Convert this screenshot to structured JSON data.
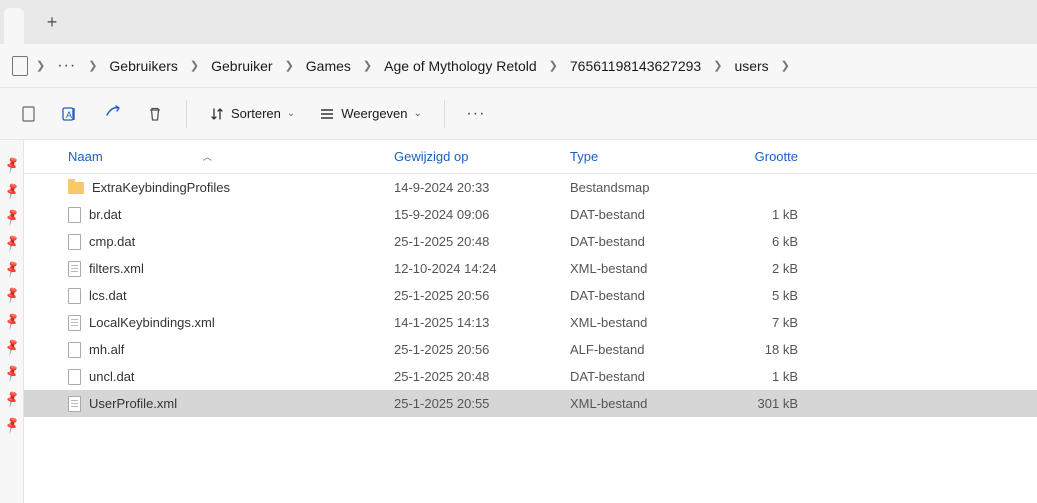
{
  "breadcrumb": [
    "Gebruikers",
    "Gebruiker",
    "Games",
    "Age of Mythology Retold",
    "76561198143627293",
    "users"
  ],
  "toolbar": {
    "sort": "Sorteren",
    "view": "Weergeven"
  },
  "columns": {
    "name": "Naam",
    "modified": "Gewijzigd op",
    "type": "Type",
    "size": "Grootte"
  },
  "files": [
    {
      "icon": "folder",
      "name": "ExtraKeybindingProfiles",
      "modified": "14-9-2024 20:33",
      "type": "Bestandsmap",
      "size": "",
      "selected": false
    },
    {
      "icon": "file",
      "name": "br.dat",
      "modified": "15-9-2024 09:06",
      "type": "DAT-bestand",
      "size": "1 kB",
      "selected": false
    },
    {
      "icon": "file",
      "name": "cmp.dat",
      "modified": "25-1-2025 20:48",
      "type": "DAT-bestand",
      "size": "6 kB",
      "selected": false
    },
    {
      "icon": "file-lines",
      "name": "filters.xml",
      "modified": "12-10-2024 14:24",
      "type": "XML-bestand",
      "size": "2 kB",
      "selected": false
    },
    {
      "icon": "file",
      "name": "lcs.dat",
      "modified": "25-1-2025 20:56",
      "type": "DAT-bestand",
      "size": "5 kB",
      "selected": false
    },
    {
      "icon": "file-lines",
      "name": "LocalKeybindings.xml",
      "modified": "14-1-2025 14:13",
      "type": "XML-bestand",
      "size": "7 kB",
      "selected": false
    },
    {
      "icon": "file",
      "name": "mh.alf",
      "modified": "25-1-2025 20:56",
      "type": "ALF-bestand",
      "size": "18 kB",
      "selected": false
    },
    {
      "icon": "file",
      "name": "uncl.dat",
      "modified": "25-1-2025 20:48",
      "type": "DAT-bestand",
      "size": "1 kB",
      "selected": false
    },
    {
      "icon": "file-lines",
      "name": "UserProfile.xml",
      "modified": "25-1-2025 20:55",
      "type": "XML-bestand",
      "size": "301 kB",
      "selected": true
    }
  ]
}
